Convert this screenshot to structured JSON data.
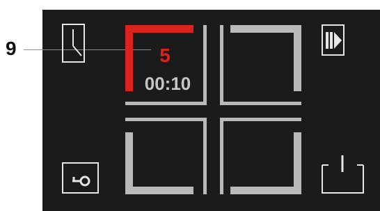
{
  "callout": {
    "number": "9"
  },
  "zone": {
    "level": "5",
    "timer": "00:10"
  },
  "colors": {
    "panel_bg": "#1b1b1b",
    "frame_gray": "#b9b9b9",
    "active_red": "#d9231d",
    "icon_white": "#e6e6e6"
  },
  "icons": {
    "timer": "clock-icon",
    "key_lock": "key-lock-icon",
    "pause_play": "pause-play-icon",
    "power": "power-icon"
  }
}
